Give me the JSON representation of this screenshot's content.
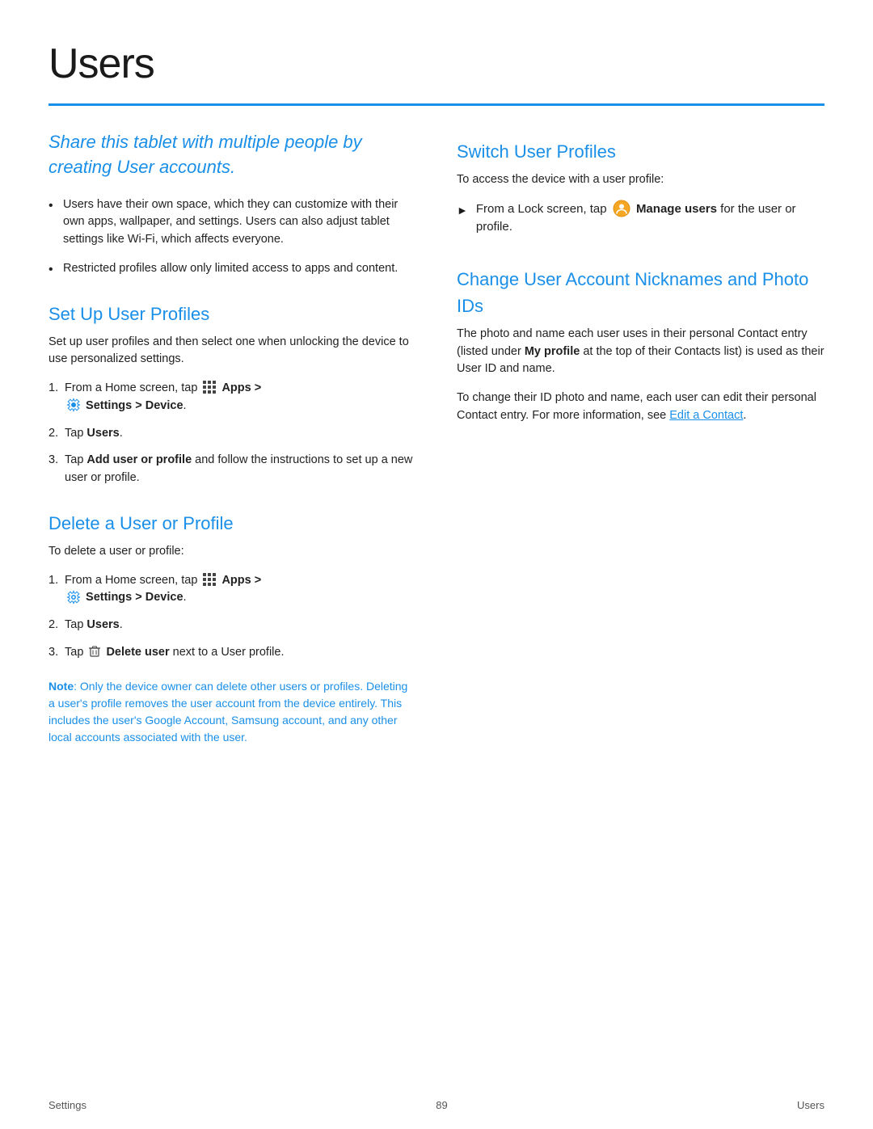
{
  "page": {
    "title": "Users",
    "footer_left": "Settings",
    "footer_center": "89",
    "footer_right": "Users"
  },
  "intro": {
    "text": "Share this tablet with multiple people by creating User accounts."
  },
  "bullets": [
    "Users have their own space, which they can customize with their own apps, wallpaper, and settings. Users can also adjust tablet settings like Wi-Fi, which affects everyone.",
    "Restricted profiles allow only limited access to apps and content."
  ],
  "set_up": {
    "title": "Set Up User Profiles",
    "desc": "Set up user profiles and then select one when unlocking the device to use personalized settings.",
    "steps": [
      {
        "text_before": "From a Home screen, tap",
        "apps_icon": true,
        "apps_label": "Apps >",
        "settings_icon": true,
        "settings_label": "Settings > Device",
        "bold_parts": [
          "Settings > Device"
        ]
      },
      {
        "plain": "Tap ",
        "bold": "Users",
        "after": "."
      },
      {
        "plain": "Tap ",
        "bold": "Add user or profile",
        "after": " and follow the instructions to set up a new user or profile."
      }
    ]
  },
  "delete": {
    "title": "Delete a User or Profile",
    "desc": "To delete a user or profile:",
    "steps": [
      {
        "text_before": "From a Home screen, tap",
        "apps_icon": true,
        "apps_label": "Apps >",
        "settings_icon": true,
        "settings_label": "Settings > Device",
        "bold_parts": [
          "Settings > Device"
        ]
      },
      {
        "plain": "Tap ",
        "bold": "Users",
        "after": "."
      },
      {
        "plain": "Tap ",
        "delete_icon": true,
        "bold": "Delete user",
        "after": " next to a User profile."
      }
    ],
    "note_label": "Note",
    "note_text": ": Only the device owner can delete other users or profiles. Deleting a user's profile removes the user account from the device entirely. This includes the user's Google Account, Samsung account, and any other local accounts associated with the user."
  },
  "switch": {
    "title": "Switch User Profiles",
    "desc": "To access the device with a user profile:",
    "step": "From a Lock screen, tap",
    "manage_label": "Manage users",
    "step_after": "for the user or profile."
  },
  "change": {
    "title": "Change User Account Nicknames and Photo IDs",
    "desc1": "The photo and name each user uses in their personal Contact entry (listed under",
    "my_profile": "My profile",
    "desc1_after": "at the top of their Contacts list) is used as their User ID and name.",
    "desc2": "To change their ID photo and name, each user can edit their personal Contact entry. For more information, see",
    "link_text": "Edit a Contact",
    "desc2_after": "."
  }
}
